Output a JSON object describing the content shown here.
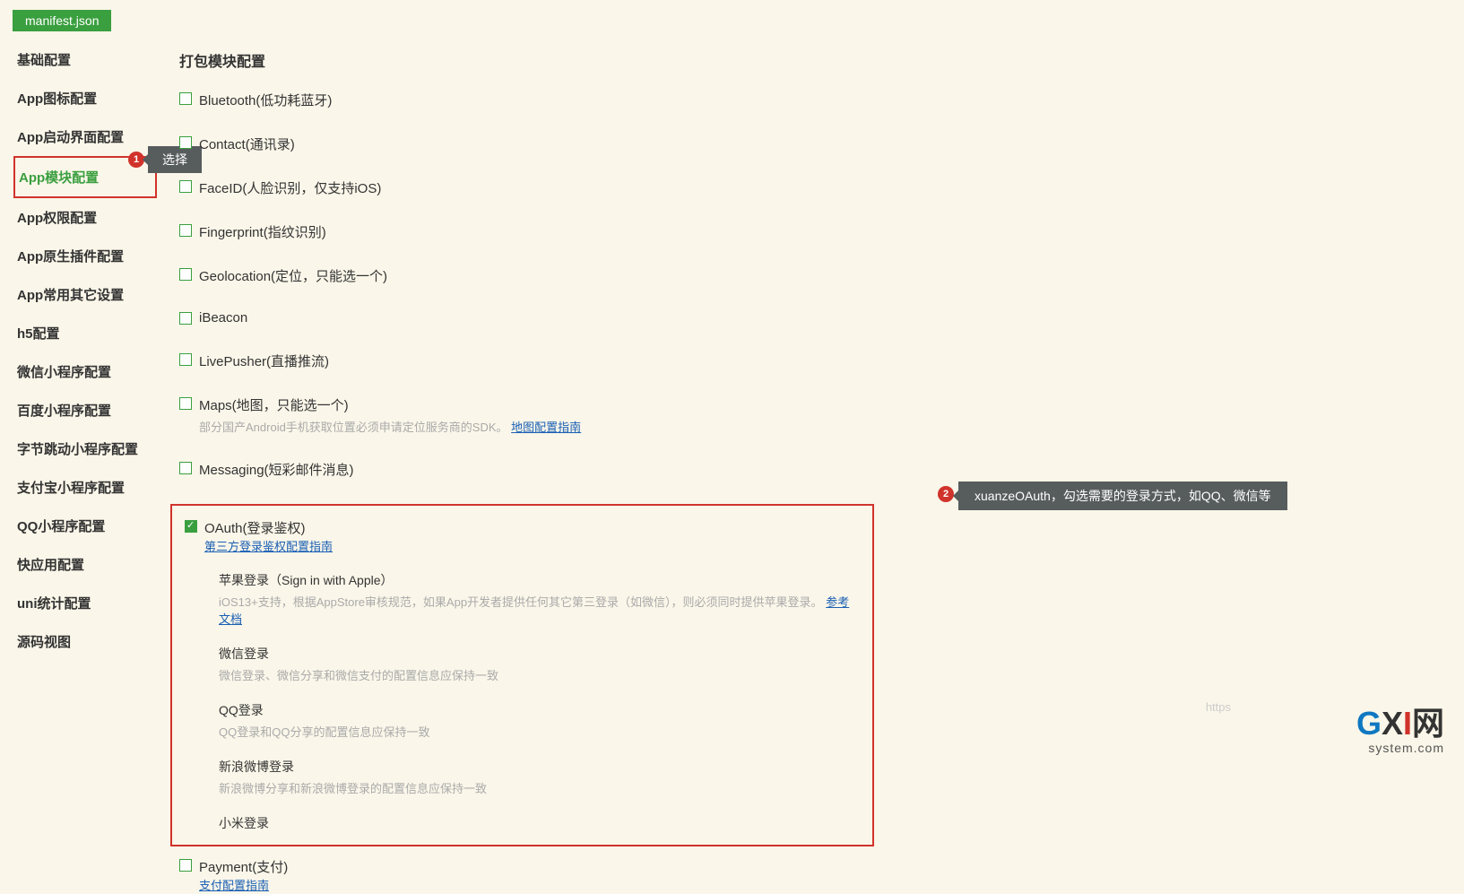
{
  "file_tab": "manifest.json",
  "sidebar": [
    {
      "label": "基础配置",
      "selected": false
    },
    {
      "label": "App图标配置",
      "selected": false
    },
    {
      "label": "App启动界面配置",
      "selected": false
    },
    {
      "label": "App模块配置",
      "selected": true
    },
    {
      "label": "App权限配置",
      "selected": false
    },
    {
      "label": "App原生插件配置",
      "selected": false
    },
    {
      "label": "App常用其它设置",
      "selected": false
    },
    {
      "label": "h5配置",
      "selected": false
    },
    {
      "label": "微信小程序配置",
      "selected": false
    },
    {
      "label": "百度小程序配置",
      "selected": false
    },
    {
      "label": "字节跳动小程序配置",
      "selected": false
    },
    {
      "label": "支付宝小程序配置",
      "selected": false
    },
    {
      "label": "QQ小程序配置",
      "selected": false
    },
    {
      "label": "快应用配置",
      "selected": false
    },
    {
      "label": "uni统计配置",
      "selected": false
    },
    {
      "label": "源码视图",
      "selected": false
    }
  ],
  "annotation1": {
    "num": "1",
    "text": "选择"
  },
  "annotation2": {
    "num": "2",
    "text": "xuanzeOAuth，勾选需要的登录方式，如QQ、微信等"
  },
  "section_title": "打包模块配置",
  "modules": [
    {
      "label": "Bluetooth(低功耗蓝牙)",
      "checked": false
    },
    {
      "label": "Contact(通讯录)",
      "checked": false
    },
    {
      "label": "FaceID(人脸识别，仅支持iOS)",
      "checked": false
    },
    {
      "label": "Fingerprint(指纹识别)",
      "checked": false
    },
    {
      "label": "Geolocation(定位，只能选一个)",
      "checked": false
    },
    {
      "label": "iBeacon",
      "checked": false
    },
    {
      "label": "LivePusher(直播推流)",
      "checked": false
    },
    {
      "label": "Maps(地图，只能选一个)",
      "checked": false,
      "desc": "部分国产Android手机获取位置必须申请定位服务商的SDK。",
      "link": "地图配置指南"
    },
    {
      "label": "Messaging(短彩邮件消息)",
      "checked": false
    }
  ],
  "oauth": {
    "label": "OAuth(登录鉴权)",
    "checked": true,
    "link": "第三方登录鉴权配置指南",
    "sub": [
      {
        "label": "苹果登录（Sign in with Apple）",
        "desc": "iOS13+支持，根据AppStore审核规范，如果App开发者提供任何其它第三登录（如微信），则必须同时提供苹果登录。",
        "link": "参考文档"
      },
      {
        "label": "微信登录",
        "desc": "微信登录、微信分享和微信支付的配置信息应保持一致"
      },
      {
        "label": "QQ登录",
        "desc": "QQ登录和QQ分享的配置信息应保持一致"
      },
      {
        "label": "新浪微博登录",
        "desc": "新浪微博分享和新浪微博登录的配置信息应保持一致"
      },
      {
        "label": "小米登录"
      }
    ]
  },
  "payment": {
    "label": "Payment(支付)",
    "link": "支付配置指南"
  },
  "url_hint": "https",
  "watermark": {
    "g": "G",
    "x": "X",
    "i": "I",
    "cn": "网",
    "sys": "system.com"
  }
}
